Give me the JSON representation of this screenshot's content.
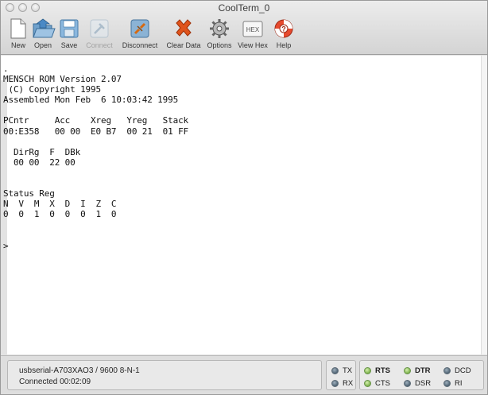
{
  "window": {
    "title": "CoolTerm_0"
  },
  "toolbar": {
    "items": [
      {
        "label": "New",
        "icon": "new-document-icon",
        "enabled": true
      },
      {
        "label": "Open",
        "icon": "open-folder-icon",
        "enabled": true
      },
      {
        "label": "Save",
        "icon": "save-floppy-icon",
        "enabled": true
      },
      {
        "label": "Connect",
        "icon": "connect-plug-icon",
        "enabled": false
      },
      {
        "label": "Disconnect",
        "icon": "disconnect-plug-icon",
        "enabled": true
      },
      {
        "label": "Clear Data",
        "icon": "clear-x-icon",
        "enabled": true
      },
      {
        "label": "Options",
        "icon": "gear-icon",
        "enabled": true
      },
      {
        "label": "View Hex",
        "icon": "hex-icon",
        "enabled": true
      },
      {
        "label": "Help",
        "icon": "lifebuoy-icon",
        "enabled": true
      }
    ],
    "hex_badge": "HEX"
  },
  "terminal": {
    "lines": [
      ".",
      "MENSCH ROM Version 2.07",
      " (C) Copyright 1995",
      "Assembled Mon Feb  6 10:03:42 1995",
      "",
      "PCntr     Acc    Xreg   Yreg   Stack",
      "00:E358   00 00  E0 B7  00 21  01 FF",
      "",
      "  DirRg  F  DBk",
      "  00 00  22 00",
      "",
      "",
      "Status Reg",
      "N  V  M  X  D  I  Z  C",
      "0  0  1  0  0  0  1  0",
      "",
      "",
      ">"
    ]
  },
  "status": {
    "port_line": "usbserial-A703XAO3 / 9600 8-N-1",
    "connection_line": "Connected 00:02:09",
    "leds": {
      "tx": {
        "label": "TX",
        "on": false
      },
      "rx": {
        "label": "RX",
        "on": false
      },
      "rts": {
        "label": "RTS",
        "on": true
      },
      "cts": {
        "label": "CTS",
        "on": true
      },
      "dtr": {
        "label": "DTR",
        "on": true
      },
      "dsr": {
        "label": "DSR",
        "on": false
      },
      "dcd": {
        "label": "DCD",
        "on": false
      },
      "ri": {
        "label": "RI",
        "on": false
      }
    },
    "colors": {
      "led_on": "#7bb04a",
      "led_off": "#4f6373"
    }
  }
}
